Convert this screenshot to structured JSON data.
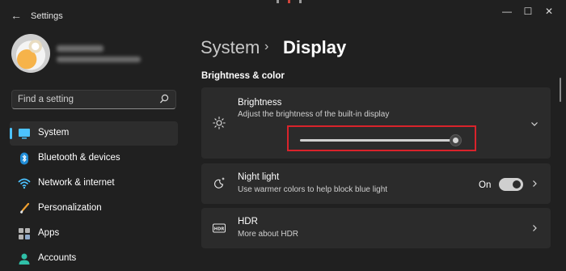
{
  "window": {
    "title": "Settings",
    "controls": {
      "minimize": "—",
      "maximize": "☐",
      "close": "✕"
    }
  },
  "sidebar": {
    "search": {
      "placeholder": "Find a setting"
    },
    "items": [
      {
        "label": "System",
        "icon": "system-icon",
        "active": true
      },
      {
        "label": "Bluetooth & devices",
        "icon": "bluetooth-icon",
        "active": false
      },
      {
        "label": "Network & internet",
        "icon": "wifi-icon",
        "active": false
      },
      {
        "label": "Personalization",
        "icon": "brush-icon",
        "active": false
      },
      {
        "label": "Apps",
        "icon": "apps-icon",
        "active": false
      },
      {
        "label": "Accounts",
        "icon": "account-icon",
        "active": false
      }
    ]
  },
  "main": {
    "breadcrumb": {
      "parent": "System",
      "separator": "›",
      "current": "Display"
    },
    "section_title": "Brightness & color",
    "cards": {
      "brightness": {
        "title": "Brightness",
        "subtitle": "Adjust the brightness of the built-in display",
        "value_fraction": 0.98
      },
      "night_light": {
        "title": "Night light",
        "subtitle": "Use warmer colors to help block blue light",
        "toggle_label": "On",
        "toggle_on": true
      },
      "hdr": {
        "title": "HDR",
        "subtitle": "More about HDR"
      }
    }
  },
  "colors": {
    "accent": "#4cc2ff",
    "highlight_box": "#d9232b",
    "background": "#202020",
    "card": "#2b2b2b"
  }
}
